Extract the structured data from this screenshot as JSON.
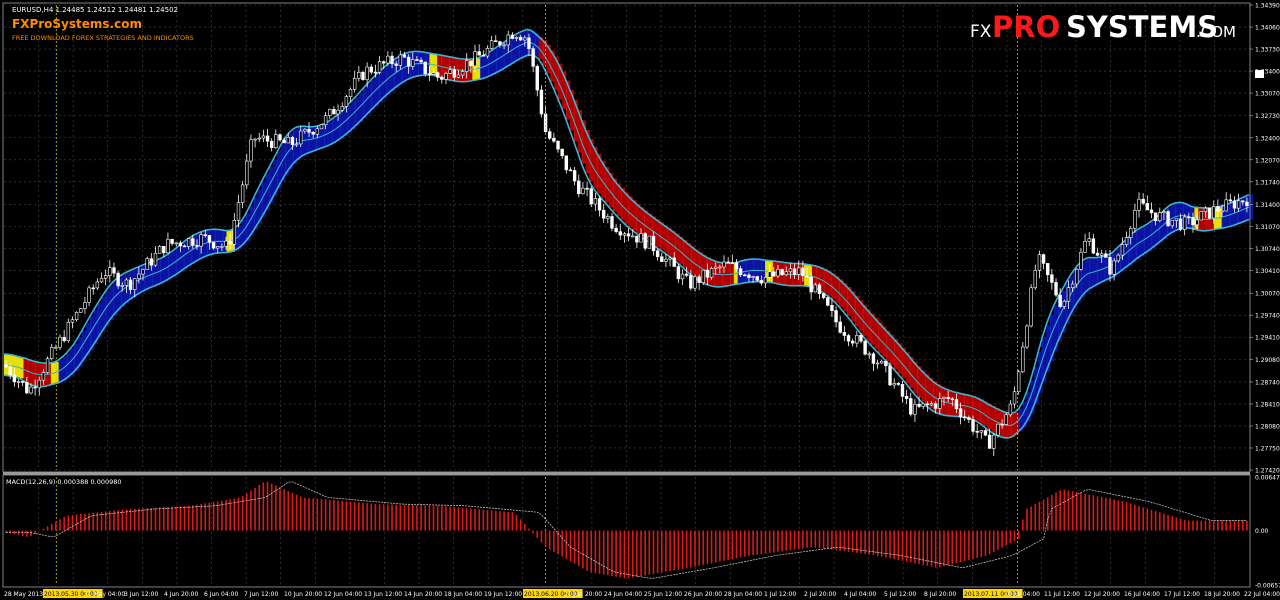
{
  "header": {
    "symbol_line": "EURUSD,H4  1.24485  1.24512  1.24481  1.24502",
    "site_logo": "FXProSystems.com",
    "site_tagline": "FREE DOWNLOAD FOREX STRATEGIES AND INDICATORS"
  },
  "watermark": {
    "prefix": "FX",
    "pro": "PRO",
    "systems": "SYSTEMS",
    "suffix": ".COM"
  },
  "macd": {
    "label": "MACD(12,26,9) 0.000388 0.000980"
  },
  "colors": {
    "background": "#000000",
    "grid": "#4a4a4a",
    "bull_band": "#0a14a0",
    "bear_band": "#b00000",
    "band_stripe_bear": "#ff3030",
    "band_stripe_bull": "#3040ff",
    "band_edge": "#3cb4d0",
    "neutral_stripe": "#e8e000",
    "candle": "#ffffff",
    "macd_bar": "#e01818",
    "macd_signal": "#d8d8d8",
    "session_line": "#c8c800",
    "logo_orange": "#ff8c00",
    "watermark_red": "#ff1818"
  },
  "chart_data": [
    {
      "type": "candlestick",
      "title": "EURUSD,H4",
      "y_ticks": [
        "1.34390",
        "1.34060",
        "1.33730",
        "1.33400",
        "1.33070",
        "1.32730",
        "1.32400",
        "1.32070",
        "1.31740",
        "1.31400",
        "1.31070",
        "1.30740",
        "1.30410",
        "1.30070",
        "1.29740",
        "1.29410",
        "1.29080",
        "1.28740",
        "1.28410",
        "1.28080",
        "1.27750",
        "1.27420"
      ],
      "ylim": [
        1.2742,
        1.3439
      ],
      "grid": true,
      "x_ticks": [
        "28 May 2013",
        "2013.05.30 00:00",
        "31 May 04:00",
        "3 Jun 12:00",
        "4 Jun 20:00",
        "6 Jun 04:00",
        "7 Jun 12:00",
        "10 Jun 20:00",
        "12 Jun 04:00",
        "13 Jun 12:00",
        "14 Jun 20:00",
        "18 Jun 04:00",
        "19 Jun 12:00",
        "2013.06.20 08:00",
        "21 Jun 20:00",
        "24 Jun 04:00",
        "25 Jun 12:00",
        "26 Jun 20:00",
        "28 Jun 04:00",
        "1 Jul 12:00",
        "2 Jul 20:00",
        "4 Jul 04:00",
        "5 Jul 12:00",
        "8 Jul 20:00",
        "2013.07.11 00:00",
        "10 Jul 04:00",
        "11 Jul 12:00",
        "12 Jul 20:00",
        "16 Jul 04:00",
        "17 Jul 12:00",
        "18 Jul 20:00",
        "22 Jul 04:00"
      ],
      "highlighted_x_ticks": [
        "2013.05.30 00:00",
        "2013.06.20 08:00",
        "2013.07.11 00:00"
      ],
      "price_path": [
        {
          "t": 0,
          "p": 1.29
        },
        {
          "t": 0.02,
          "p": 1.286
        },
        {
          "t": 0.05,
          "p": 1.295
        },
        {
          "t": 0.08,
          "p": 1.304
        },
        {
          "t": 0.1,
          "p": 1.302
        },
        {
          "t": 0.13,
          "p": 1.308
        },
        {
          "t": 0.16,
          "p": 1.309
        },
        {
          "t": 0.18,
          "p": 1.3075
        },
        {
          "t": 0.2,
          "p": 1.324
        },
        {
          "t": 0.23,
          "p": 1.323
        },
        {
          "t": 0.26,
          "p": 1.327
        },
        {
          "t": 0.29,
          "p": 1.334
        },
        {
          "t": 0.32,
          "p": 1.336
        },
        {
          "t": 0.35,
          "p": 1.333
        },
        {
          "t": 0.38,
          "p": 1.336
        },
        {
          "t": 0.41,
          "p": 1.34
        },
        {
          "t": 0.42,
          "p": 1.339
        },
        {
          "t": 0.435,
          "p": 1.325
        },
        {
          "t": 0.46,
          "p": 1.317
        },
        {
          "t": 0.49,
          "p": 1.311
        },
        {
          "t": 0.52,
          "p": 1.308
        },
        {
          "t": 0.55,
          "p": 1.302
        },
        {
          "t": 0.58,
          "p": 1.305
        },
        {
          "t": 0.61,
          "p": 1.303
        },
        {
          "t": 0.64,
          "p": 1.304
        },
        {
          "t": 0.67,
          "p": 1.296
        },
        {
          "t": 0.7,
          "p": 1.291
        },
        {
          "t": 0.73,
          "p": 1.283
        },
        {
          "t": 0.76,
          "p": 1.285
        },
        {
          "t": 0.79,
          "p": 1.278
        },
        {
          "t": 0.81,
          "p": 1.284
        },
        {
          "t": 0.83,
          "p": 1.306
        },
        {
          "t": 0.85,
          "p": 1.299
        },
        {
          "t": 0.87,
          "p": 1.309
        },
        {
          "t": 0.89,
          "p": 1.304
        },
        {
          "t": 0.91,
          "p": 1.314
        },
        {
          "t": 0.93,
          "p": 1.312
        },
        {
          "t": 0.95,
          "p": 1.311
        },
        {
          "t": 0.97,
          "p": 1.313
        },
        {
          "t": 1.0,
          "p": 1.315
        }
      ]
    },
    {
      "type": "bar",
      "title": "MACD(12,26,9)",
      "y_ticks": [
        "0.006473",
        "0.00",
        "-0.006573"
      ],
      "ylim": [
        -0.006573,
        0.006473
      ],
      "histogram": [
        {
          "t": 0,
          "v": -0.0002
        },
        {
          "t": 0.02,
          "v": -0.0008
        },
        {
          "t": 0.05,
          "v": 0.0018
        },
        {
          "t": 0.1,
          "v": 0.0026
        },
        {
          "t": 0.15,
          "v": 0.003
        },
        {
          "t": 0.19,
          "v": 0.004
        },
        {
          "t": 0.21,
          "v": 0.006
        },
        {
          "t": 0.24,
          "v": 0.004
        },
        {
          "t": 0.3,
          "v": 0.0032
        },
        {
          "t": 0.35,
          "v": 0.003
        },
        {
          "t": 0.41,
          "v": 0.0022
        },
        {
          "t": 0.435,
          "v": -0.002
        },
        {
          "t": 0.47,
          "v": -0.005
        },
        {
          "t": 0.5,
          "v": -0.0058
        },
        {
          "t": 0.55,
          "v": -0.0045
        },
        {
          "t": 0.6,
          "v": -0.003
        },
        {
          "t": 0.65,
          "v": -0.002
        },
        {
          "t": 0.7,
          "v": -0.003
        },
        {
          "t": 0.75,
          "v": -0.0045
        },
        {
          "t": 0.79,
          "v": -0.003
        },
        {
          "t": 0.815,
          "v": -0.001
        },
        {
          "t": 0.82,
          "v": 0.0025
        },
        {
          "t": 0.85,
          "v": 0.005
        },
        {
          "t": 0.9,
          "v": 0.0035
        },
        {
          "t": 0.95,
          "v": 0.0012
        },
        {
          "t": 1.0,
          "v": 0.0012
        }
      ]
    }
  ]
}
